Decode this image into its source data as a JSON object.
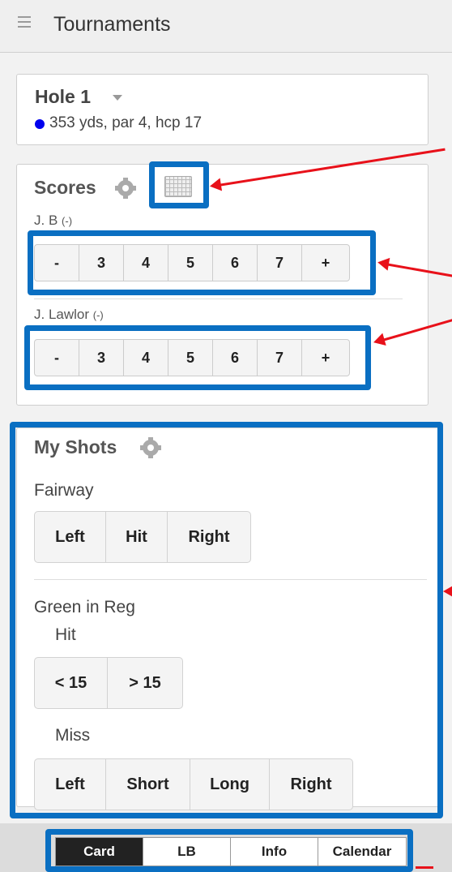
{
  "header": {
    "title": "Tournaments"
  },
  "hole": {
    "title": "Hole 1",
    "info": "353 yds, par 4, hcp 17",
    "tee_color": "#0000ee"
  },
  "scores": {
    "title": "Scores",
    "players": [
      {
        "name": "J. B",
        "handicap": "(-)",
        "buttons": [
          "-",
          "3",
          "4",
          "5",
          "6",
          "7",
          "+"
        ]
      },
      {
        "name": "J. Lawlor",
        "handicap": "(-)",
        "buttons": [
          "-",
          "3",
          "4",
          "5",
          "6",
          "7",
          "+"
        ]
      }
    ]
  },
  "shots": {
    "title": "My Shots",
    "fairway": {
      "label": "Fairway",
      "options": [
        "Left",
        "Hit",
        "Right"
      ]
    },
    "gir": {
      "label": "Green in Reg",
      "hit_label": "Hit",
      "hit_options": [
        "< 15",
        "> 15"
      ],
      "miss_label": "Miss",
      "miss_options": [
        "Left",
        "Short",
        "Long",
        "Right"
      ]
    }
  },
  "tabs": [
    {
      "label": "Card",
      "active": true
    },
    {
      "label": "LB",
      "active": false
    },
    {
      "label": "Info",
      "active": false
    },
    {
      "label": "Calendar",
      "active": false
    }
  ],
  "colors": {
    "highlight": "#0a6fc2",
    "arrow": "#e8111a",
    "active_tab": "#222222"
  }
}
